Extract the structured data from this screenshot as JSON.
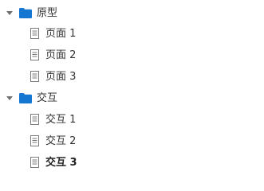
{
  "colors": {
    "folder": "#1677d2",
    "caret": "#6f6f6f",
    "page_icon": "#7a7a7a",
    "text": "#333333"
  },
  "tree": [
    {
      "label": "原型",
      "icon": "folder-icon",
      "expanded": true,
      "children": [
        {
          "label": "页面 1",
          "icon": "page-icon"
        },
        {
          "label": "页面 2",
          "icon": "page-icon"
        },
        {
          "label": "页面 3",
          "icon": "page-icon"
        }
      ]
    },
    {
      "label": "交互",
      "icon": "folder-icon",
      "expanded": true,
      "children": [
        {
          "label": "交互 1",
          "icon": "page-icon"
        },
        {
          "label": "交互 2",
          "icon": "page-icon"
        },
        {
          "label": "交互 3",
          "icon": "page-icon",
          "selected": true
        }
      ]
    }
  ]
}
